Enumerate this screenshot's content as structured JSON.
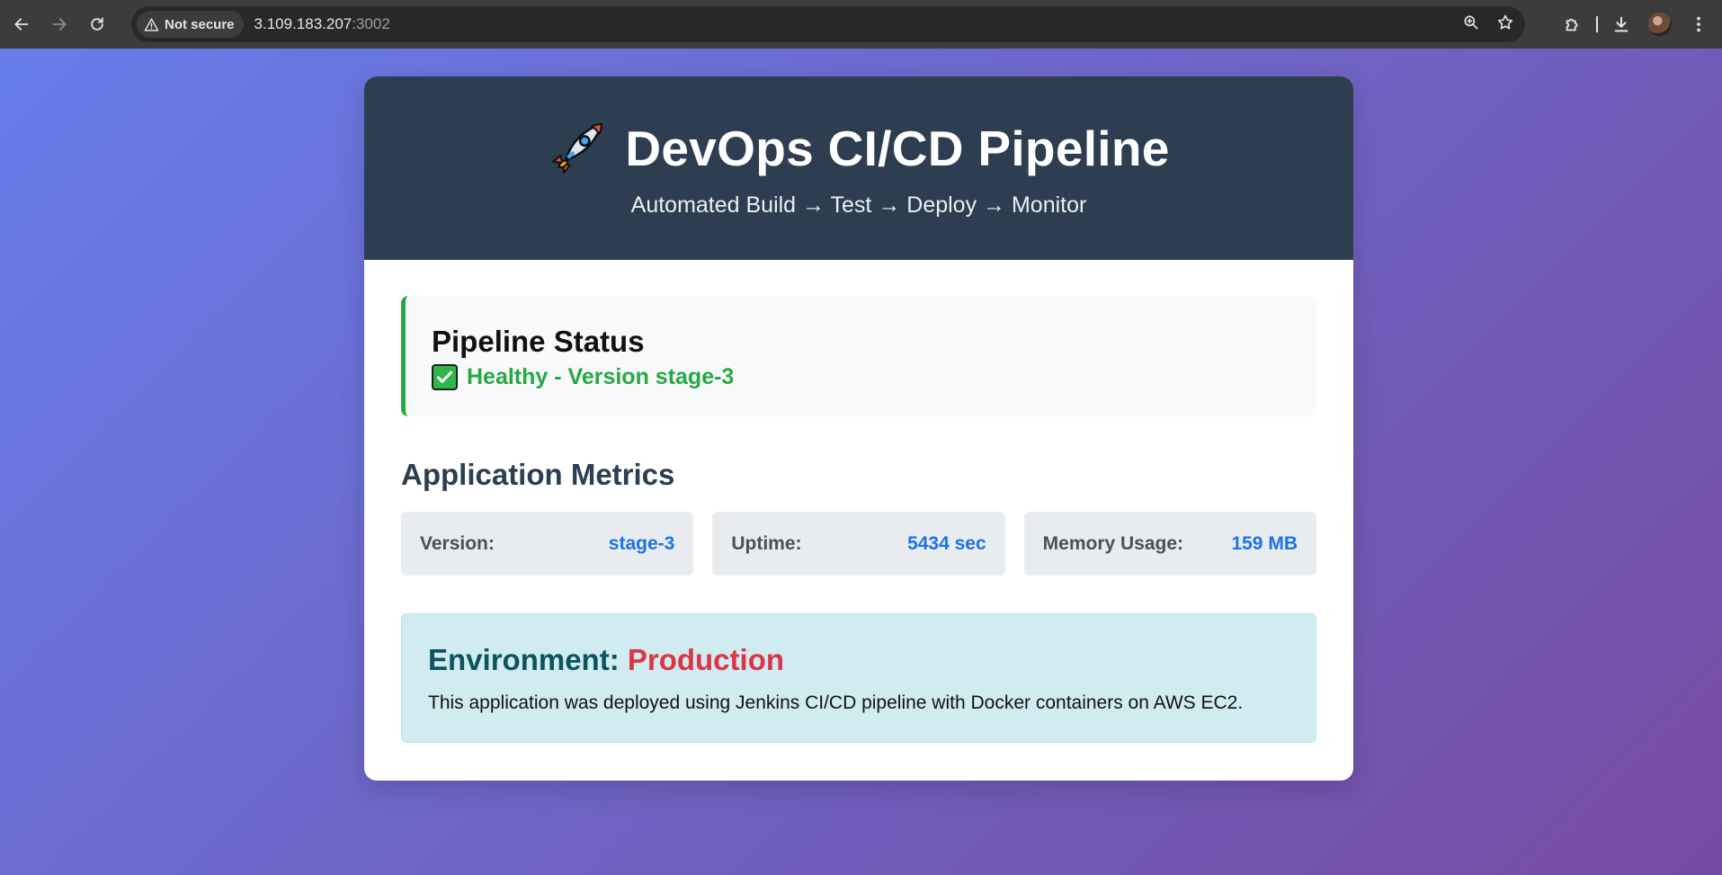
{
  "browser": {
    "security_label": "Not secure",
    "url_host": "3.109.183.207",
    "url_port": ":3002"
  },
  "header": {
    "title": "DevOps CI/CD Pipeline",
    "subtitle": "Automated Build → Test → Deploy → Monitor",
    "icon": "rocket-icon"
  },
  "status": {
    "title": "Pipeline Status",
    "text": "Healthy - Version stage-3",
    "icon": "check-mark-icon",
    "accent_color": "#28a745"
  },
  "metrics": {
    "title": "Application Metrics",
    "items": [
      {
        "label": "Version:",
        "value": "stage-3"
      },
      {
        "label": "Uptime:",
        "value": "5434 sec"
      },
      {
        "label": "Memory Usage:",
        "value": "159 MB"
      }
    ]
  },
  "environment": {
    "label": "Environment:",
    "value": "Production",
    "description": "This application was deployed using Jenkins CI/CD pipeline with Docker containers on AWS EC2."
  },
  "colors": {
    "header_bg": "#2c3e50",
    "metric_value": "#1a73e8",
    "environment_value": "#dc3545",
    "background_gradient": [
      "#667eea",
      "#764ba2"
    ]
  }
}
